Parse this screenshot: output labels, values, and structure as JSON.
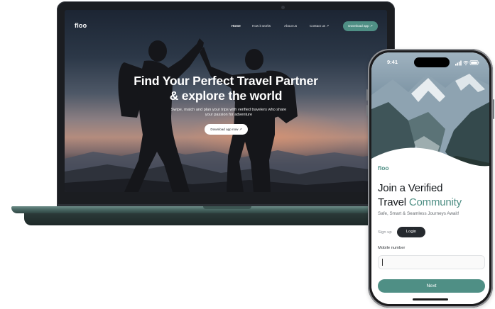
{
  "laptop": {
    "nav": {
      "logo": "floo",
      "links": [
        {
          "label": "Home",
          "active": true
        },
        {
          "label": "How it works",
          "active": false
        },
        {
          "label": "About us",
          "active": false
        },
        {
          "label": "Contact us ↗",
          "active": false
        }
      ],
      "cta_label": "Download app ↗"
    },
    "hero": {
      "title_line1": "Find Your Perfect Travel Partner",
      "title_line2": "& explore the world",
      "subtitle_line1": "Swipe, match and plan your trips with verified travelers who share",
      "subtitle_line2": "your passion for adventure",
      "cta_label": "Download app now ↗"
    }
  },
  "phone": {
    "status": {
      "time": "9:41"
    },
    "logo": "floo",
    "title_line1": "Join a Verified",
    "title_word": "Travel",
    "title_accent": "Community",
    "subtitle": "Safe, Smart & Seamless Journeys Await!",
    "tabs": {
      "signup": "Sign up",
      "login": "Login",
      "active": "login"
    },
    "mobile_label": "Mobile number",
    "mobile_value": "",
    "next_label": "Next"
  },
  "colors": {
    "accent": "#4f8f85",
    "dark": "#25292e",
    "laptop_base": "#4e6c68"
  },
  "icons": [
    "camera-icon",
    "signal-icon",
    "wifi-icon",
    "battery-icon",
    "arrow-up-right-icon"
  ]
}
